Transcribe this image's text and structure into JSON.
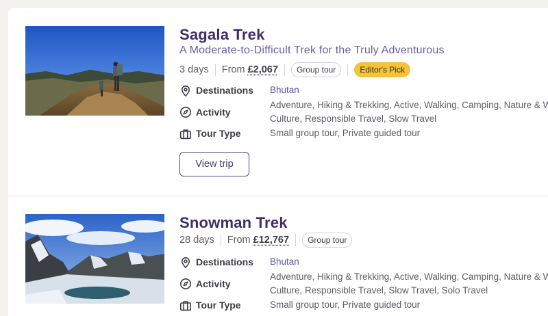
{
  "trips": [
    {
      "title": "Sagala Trek",
      "subtitle": "A Moderate-to-Difficult Trek for the Truly Adventurous",
      "duration": "3 days",
      "from_label": "From",
      "price": "£2,067",
      "badges": [
        "Group tour",
        "Editor's Pick"
      ],
      "destinations_label": "Destinations",
      "destinations_value": "Bhutan",
      "activity_label": "Activity",
      "activity_line1": "Adventure, Hiking & Trekking, Active, Walking, Camping, Nature & W",
      "activity_line2": "Culture, Responsible Travel, Slow Travel",
      "tour_type_label": "Tour Type",
      "tour_type_value": "Small group tour, Private guided tour",
      "button": "View trip"
    },
    {
      "title": "Snowman Trek",
      "duration": "28 days",
      "from_label": "From",
      "price": "£12,767",
      "badges": [
        "Group tour"
      ],
      "destinations_label": "Destinations",
      "destinations_value": "Bhutan",
      "activity_label": "Activity",
      "activity_line1": "Adventure, Hiking & Trekking, Active, Walking, Camping, Nature & W",
      "activity_line2": "Culture, Responsible Travel, Slow Travel, Solo Travel",
      "tour_type_label": "Tour Type",
      "tour_type_value": "Small group tour, Private guided tour"
    }
  ],
  "colors": {
    "title": "#3e2d6b",
    "subtitle": "#6a5fa0",
    "link": "#5a58a8",
    "editor_pick_bg": "#f3c33c"
  },
  "icons": [
    "map-pin-icon",
    "compass-icon",
    "briefcase-icon"
  ]
}
